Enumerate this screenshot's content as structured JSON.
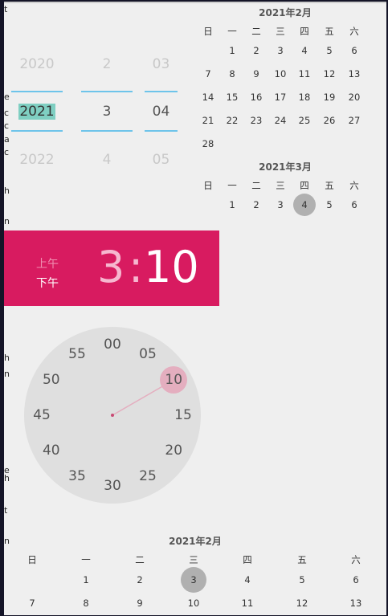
{
  "left_edge_chars": [
    "t",
    "",
    "e",
    "c",
    "c",
    "a",
    "c",
    "h",
    "n",
    "",
    "n",
    "",
    "h",
    "n",
    "",
    "e",
    "h",
    "t",
    "n"
  ],
  "picker": {
    "year": {
      "prev": "2020",
      "selected": "2021",
      "next": "2022"
    },
    "month": {
      "prev": "2",
      "selected": "3",
      "next": "4"
    },
    "day": {
      "prev": "03",
      "selected": "04",
      "next": "05"
    }
  },
  "weekdays": [
    "日",
    "一",
    "二",
    "三",
    "四",
    "五",
    "六"
  ],
  "cal_feb": {
    "title": "2021年2月",
    "rows": [
      [
        "",
        "1",
        "2",
        "3",
        "4",
        "5",
        "6"
      ],
      [
        "7",
        "8",
        "9",
        "10",
        "11",
        "12",
        "13"
      ],
      [
        "14",
        "15",
        "16",
        "17",
        "18",
        "19",
        "20"
      ],
      [
        "21",
        "22",
        "23",
        "24",
        "25",
        "26",
        "27"
      ],
      [
        "28",
        "",
        "",
        "",
        "",
        "",
        ""
      ]
    ]
  },
  "cal_mar": {
    "title": "2021年3月",
    "rows": [
      [
        "",
        "1",
        "2",
        "3",
        "4",
        "5",
        "6"
      ]
    ],
    "selected": "4"
  },
  "time": {
    "am": "上午",
    "pm": "下午",
    "hour": "3",
    "colon": ":",
    "minute": "10"
  },
  "clock": {
    "numbers": [
      "00",
      "05",
      "10",
      "15",
      "20",
      "25",
      "30",
      "35",
      "40",
      "45",
      "50",
      "55"
    ],
    "selected": "10"
  },
  "bottom_cal": {
    "title": "2021年2月",
    "rows": [
      [
        "",
        "1",
        "2",
        "3",
        "4",
        "5",
        "6"
      ],
      [
        "7",
        "8",
        "9",
        "10",
        "11",
        "12",
        "13"
      ]
    ],
    "selected": "3"
  },
  "colors": {
    "accent": "#d81b60",
    "picker_line": "#6ec4ea",
    "clock_face": "#dfdfdf",
    "selected_day": "#b0b0b0"
  }
}
